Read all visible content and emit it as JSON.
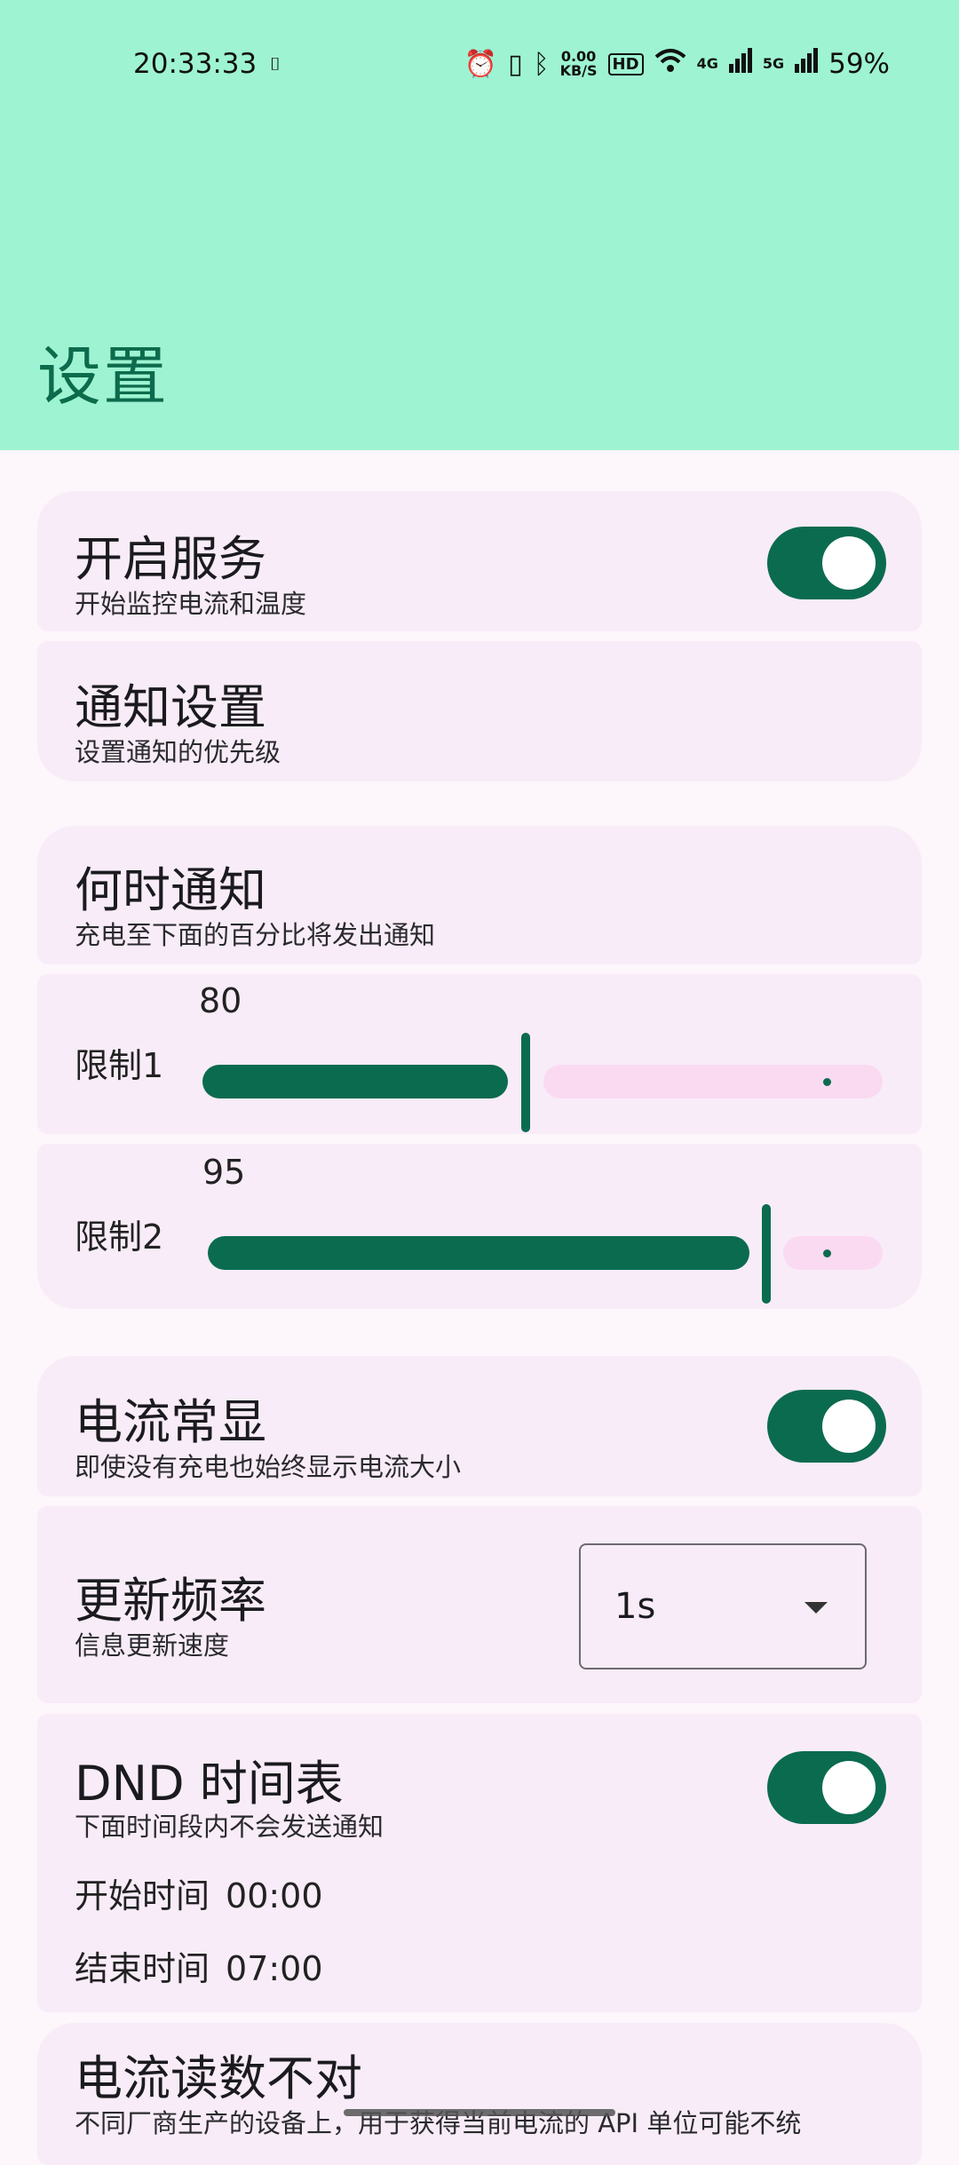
{
  "status_bar": {
    "time": "20:33:33",
    "speed_value": "0.00",
    "speed_unit": "KB/S",
    "hd_label": "HD",
    "net1": "4G",
    "net2": "5G",
    "battery": "59%"
  },
  "header": {
    "title": "设置"
  },
  "service": {
    "title": "开启服务",
    "subtitle": "开始监控电流和温度",
    "enabled": true
  },
  "notify_settings": {
    "title": "通知设置",
    "subtitle": "设置通知的优先级"
  },
  "when_notify": {
    "title": "何时通知",
    "subtitle": "充电至下面的百分比将发出通知"
  },
  "limit1": {
    "label": "限制1",
    "value": "80"
  },
  "limit2": {
    "label": "限制2",
    "value": "95"
  },
  "always_show": {
    "title": "电流常显",
    "subtitle": "即使没有充电也始终显示电流大小",
    "enabled": true
  },
  "update_rate": {
    "title": "更新频率",
    "subtitle": "信息更新速度",
    "selected": "1s"
  },
  "dnd": {
    "title": "DND 时间表",
    "subtitle": "下面时间段内不会发送通知",
    "enabled": true,
    "start_label": "开始时间",
    "start_value": "00:00",
    "end_label": "结束时间",
    "end_value": "07:00"
  },
  "wrong_reading": {
    "title": "电流读数不对",
    "subtitle": "不同厂商生产的设备上，用于获得当前电流的 API 单位可能不统"
  },
  "colors": {
    "accent": "#0b6b4f",
    "header_bg": "#9ef4d2",
    "card_bg": "#f8ecf8",
    "track_inactive": "#fadaf1"
  }
}
